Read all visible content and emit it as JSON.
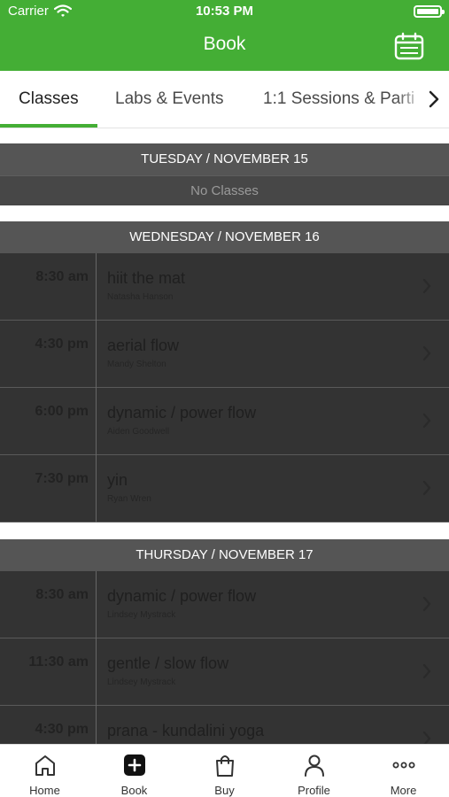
{
  "status_bar": {
    "carrier": "Carrier",
    "time": "10:53 PM"
  },
  "nav": {
    "title": "Book"
  },
  "tabs": [
    {
      "label": "Classes",
      "active": true
    },
    {
      "label": "Labs & Events",
      "active": false
    },
    {
      "label": "1:1 Sessions & Parti",
      "active": false
    }
  ],
  "schedule": [
    {
      "date": "TUESDAY / NOVEMBER 15",
      "empty_text": "No Classes",
      "classes": []
    },
    {
      "date": "WEDNESDAY / NOVEMBER 16",
      "classes": [
        {
          "time": "8:30 am",
          "name": "hiit the mat",
          "instructor": "Natasha Hanson"
        },
        {
          "time": "4:30 pm",
          "name": "aerial flow",
          "instructor": "Mandy Shelton"
        },
        {
          "time": "6:00 pm",
          "name": "dynamic / power flow",
          "instructor": "Aiden Goodwell"
        },
        {
          "time": "7:30 pm",
          "name": "yin",
          "instructor": "Ryan Wren"
        }
      ]
    },
    {
      "date": "THURSDAY / NOVEMBER 17",
      "classes": [
        {
          "time": "8:30 am",
          "name": "dynamic / power flow",
          "instructor": "Lindsey Mystrack"
        },
        {
          "time": "11:30 am",
          "name": "gentle / slow flow",
          "instructor": "Lindsey Mystrack"
        },
        {
          "time": "4:30 pm",
          "name": "prana - kundalini yoga",
          "instructor": ""
        }
      ]
    }
  ],
  "tab_bar": [
    {
      "label": "Home",
      "icon": "home-icon"
    },
    {
      "label": "Book",
      "icon": "plus-square-icon"
    },
    {
      "label": "Buy",
      "icon": "shopping-bag-icon"
    },
    {
      "label": "Profile",
      "icon": "person-icon"
    },
    {
      "label": "More",
      "icon": "ellipsis-icon"
    }
  ],
  "colors": {
    "accent": "#44ae35",
    "day_header": "#555555",
    "row_overlay": "#333333"
  }
}
